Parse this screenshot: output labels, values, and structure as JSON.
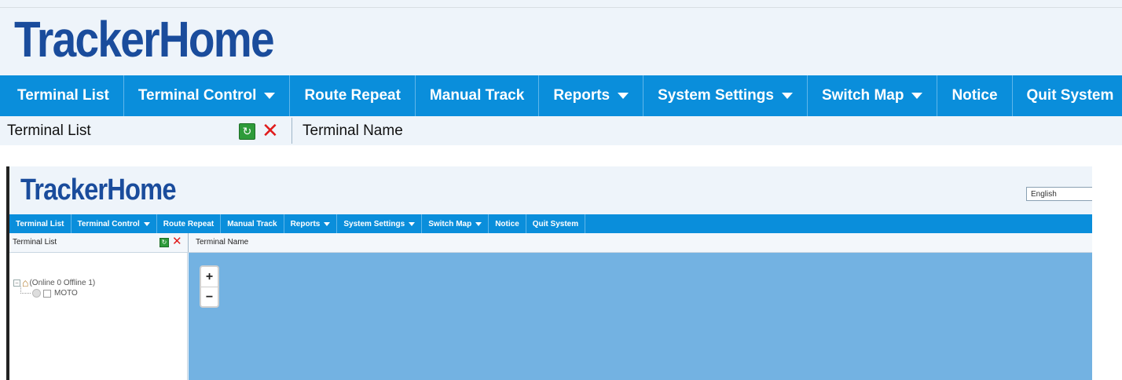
{
  "app": {
    "logo_text": "TrackerHome",
    "language": "English"
  },
  "nav": {
    "items": [
      {
        "label": "Terminal List",
        "dropdown": false
      },
      {
        "label": "Terminal Control",
        "dropdown": true
      },
      {
        "label": "Route Repeat",
        "dropdown": false
      },
      {
        "label": "Manual Track",
        "dropdown": false
      },
      {
        "label": "Reports",
        "dropdown": true
      },
      {
        "label": "System Settings",
        "dropdown": true
      },
      {
        "label": "Switch Map",
        "dropdown": true
      },
      {
        "label": "Notice",
        "dropdown": false
      },
      {
        "label": "Quit System",
        "dropdown": false
      }
    ]
  },
  "subheader": {
    "list_title": "Terminal List",
    "column_title": "Terminal Name",
    "refresh_icon": "refresh-icon",
    "delete_icon": "delete-icon"
  },
  "tree": {
    "root_label": "(Online 0   Offline 1)",
    "children": [
      {
        "label": "MOTO"
      }
    ]
  },
  "map": {
    "zoom_in": "+",
    "zoom_out": "−"
  },
  "colors": {
    "brand": "#1a4c9c",
    "nav_bg": "#0a8edb",
    "map_bg": "#73b2e2",
    "delete": "#e01b1b",
    "refresh": "#2e9b3a"
  }
}
